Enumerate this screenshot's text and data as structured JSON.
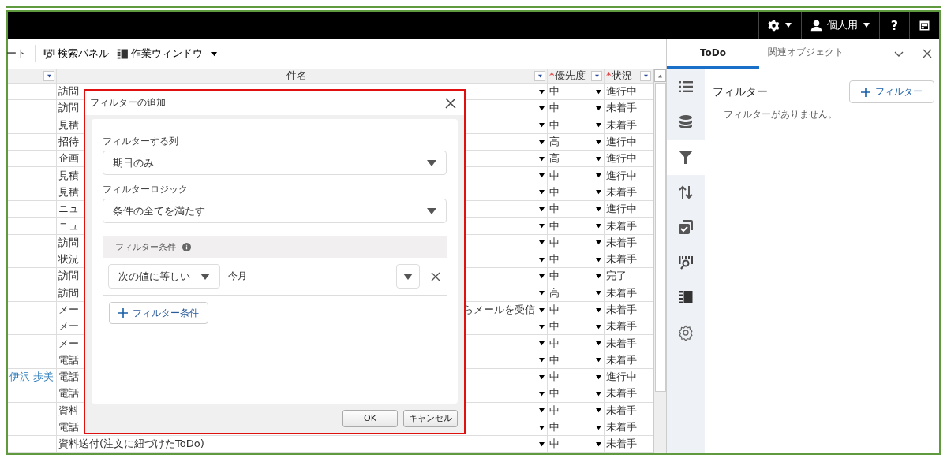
{
  "top_bar": {
    "user_label": "個人用",
    "help_label": "?"
  },
  "toolbar": {
    "items": [
      {
        "kind": "text",
        "label": "ート"
      },
      {
        "kind": "search-panel",
        "label": "検索パネル"
      },
      {
        "kind": "work-window",
        "label": "作業ウィンドウ"
      }
    ]
  },
  "table": {
    "columns": [
      {
        "label": "件名"
      },
      {
        "mark": "*",
        "label": "優先度"
      },
      {
        "mark": "*",
        "label": "状況"
      }
    ],
    "rows": [
      {
        "subject": "訪問",
        "priority": "中",
        "status": "進行中"
      },
      {
        "subject": "訪問",
        "priority": "中",
        "status": "未着手"
      },
      {
        "subject": "見積",
        "priority": "中",
        "status": "未着手"
      },
      {
        "subject": "招待",
        "priority": "高",
        "status": "進行中"
      },
      {
        "subject": "企画",
        "priority": "高",
        "status": "進行中"
      },
      {
        "subject": "見積",
        "priority": "中",
        "status": "進行中"
      },
      {
        "subject": "見積",
        "priority": "中",
        "status": "未着手"
      },
      {
        "subject": "ニュ",
        "priority": "中",
        "status": "進行中"
      },
      {
        "subject": "ニュ",
        "priority": "中",
        "status": "未着手"
      },
      {
        "subject": "訪問",
        "priority": "中",
        "status": "未着手"
      },
      {
        "subject": "状況",
        "priority": "中",
        "status": "未着手"
      },
      {
        "subject": "訪問",
        "priority": "中",
        "status": "完了"
      },
      {
        "subject": "訪問",
        "priority": "高",
        "status": "未着手"
      },
      {
        "subject": "メー",
        "subject_end": "らメールを受信",
        "priority": "中",
        "status": "未着手"
      },
      {
        "subject": "メー",
        "priority": "中",
        "status": "未着手"
      },
      {
        "subject": "メー",
        "priority": "中",
        "status": "未着手"
      },
      {
        "subject": "電話",
        "priority": "中",
        "status": "未着手"
      },
      {
        "owner": "伊沢 歩美",
        "subject": "電話",
        "priority": "中",
        "status": "進行中"
      },
      {
        "subject": "電話",
        "priority": "中",
        "status": "未着手"
      },
      {
        "subject": "資料",
        "priority": "中",
        "status": "未着手"
      },
      {
        "subject": "電話",
        "priority": "中",
        "status": "未着手"
      },
      {
        "subject": "資料送付(注文に紐づけたToDo)",
        "priority": "中",
        "status": "未着手"
      }
    ]
  },
  "dialog": {
    "title": "フィルターの追加",
    "fields": [
      {
        "label": "フィルターする列",
        "value": "期日のみ"
      },
      {
        "label": "フィルターロジック",
        "value": "条件の全てを満たす"
      }
    ],
    "conditions_header": "フィルター条件",
    "conditions": [
      {
        "operator": "次の値に等しい",
        "value": "今月"
      }
    ],
    "add_condition": "フィルター条件",
    "buttons": [
      "OK",
      "キャンセル"
    ]
  },
  "side_panel": {
    "tabs": [
      {
        "label": "ToDo",
        "selected": true
      },
      {
        "label": "関連オブジェクト",
        "selected": false
      }
    ],
    "rail": [
      {
        "kind": "list",
        "selected": false
      },
      {
        "kind": "database",
        "selected": false
      },
      {
        "kind": "filter",
        "selected": true
      },
      {
        "kind": "sort",
        "selected": false
      },
      {
        "kind": "copy-check",
        "selected": false
      },
      {
        "kind": "search-panel",
        "selected": false
      },
      {
        "kind": "work-window",
        "selected": false
      },
      {
        "kind": "settings",
        "selected": false
      }
    ],
    "title": "フィルター",
    "add_button": "フィルター",
    "empty_message": "フィルターがありません。"
  }
}
